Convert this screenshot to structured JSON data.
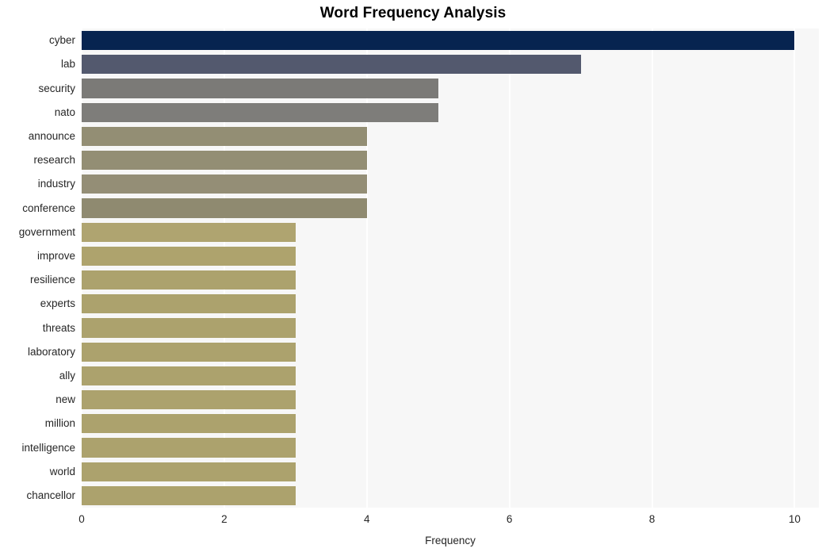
{
  "chart_data": {
    "type": "bar",
    "orientation": "horizontal",
    "title": "Word Frequency Analysis",
    "xlabel": "Frequency",
    "ylabel": "",
    "categories": [
      "cyber",
      "lab",
      "security",
      "nato",
      "announce",
      "research",
      "industry",
      "conference",
      "government",
      "improve",
      "resilience",
      "experts",
      "threats",
      "laboratory",
      "ally",
      "new",
      "million",
      "intelligence",
      "world",
      "chancellor"
    ],
    "values": [
      10,
      7,
      5,
      5,
      4,
      4,
      4,
      4,
      3,
      3,
      3,
      3,
      3,
      3,
      3,
      3,
      3,
      3,
      3,
      3
    ],
    "bar_colors": [
      "#072450",
      "#53596e",
      "#7b7a77",
      "#7e7d7a",
      "#938e74",
      "#938e74",
      "#948e76",
      "#8f8a70",
      "#afa470",
      "#aea36d",
      "#aca26d",
      "#aca26d",
      "#aca26d",
      "#aca26d",
      "#aca26d",
      "#aca26d",
      "#aca26d",
      "#aca26d",
      "#aca26d",
      "#aca26d"
    ],
    "xticks": [
      0,
      2,
      4,
      6,
      8,
      10
    ],
    "xtick_labels": [
      "0",
      "2",
      "4",
      "6",
      "8",
      "10"
    ],
    "xlim": [
      0,
      10.34
    ],
    "grid": true,
    "grid_color": "#ffffff",
    "plot_background": "#f7f7f7",
    "figure_background": "#ffffff",
    "legend": null
  }
}
